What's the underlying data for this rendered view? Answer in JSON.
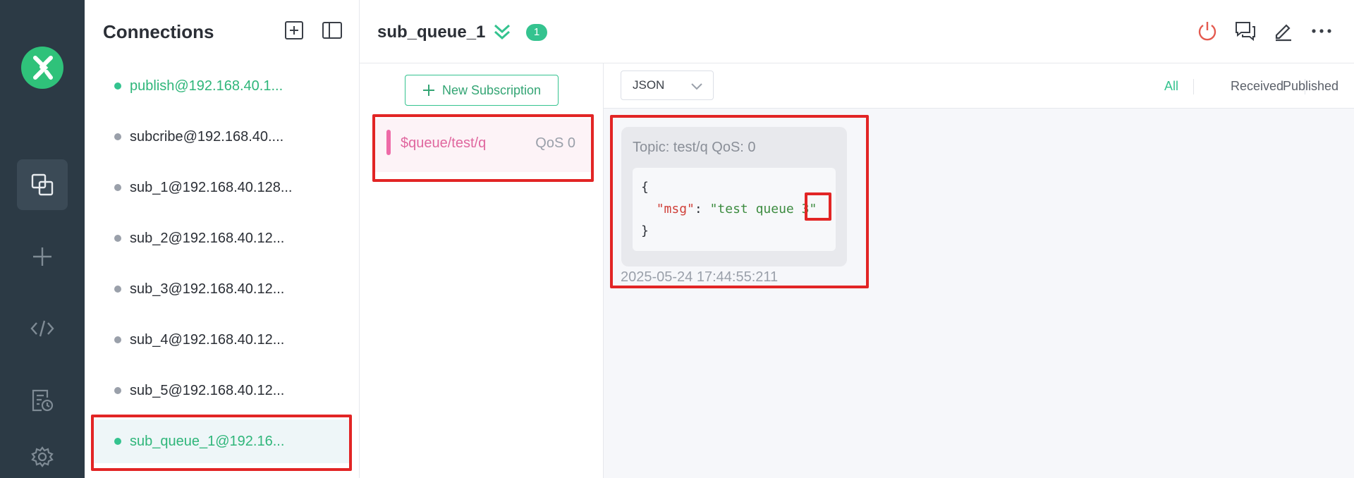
{
  "rail": {
    "logo_icon": "mqttx-logo-icon",
    "items": [
      {
        "icon": "connections-icon",
        "active": true
      },
      {
        "icon": "plus-icon"
      },
      {
        "icon": "code-icon"
      },
      {
        "icon": "log-icon"
      },
      {
        "icon": "gear-icon"
      }
    ]
  },
  "connections": {
    "title": "Connections",
    "items": [
      {
        "label": "publish@192.168.40.1...",
        "online": true
      },
      {
        "label": "subcribe@192.168.40....",
        "online": false
      },
      {
        "label": "sub_1@192.168.40.128...",
        "online": false
      },
      {
        "label": "sub_2@192.168.40.12...",
        "online": false
      },
      {
        "label": "sub_3@192.168.40.12...",
        "online": false
      },
      {
        "label": "sub_4@192.168.40.12...",
        "online": false
      },
      {
        "label": "sub_5@192.168.40.12...",
        "online": false
      },
      {
        "label": "sub_queue_1@192.16...",
        "online": true,
        "selected": true
      }
    ]
  },
  "topbar": {
    "title": "sub_queue_1",
    "badge": "1"
  },
  "subscriptions": {
    "new_label": "New Subscription",
    "items": [
      {
        "topic": "$queue/test/q",
        "qos": "QoS 0",
        "color": "#ee6aa7"
      }
    ]
  },
  "messages": {
    "format": "JSON",
    "filters": {
      "all": "All",
      "received": "Received",
      "published": "Published"
    },
    "card": {
      "meta": "Topic: test/q    QoS: 0",
      "brace_open": "{",
      "key": "\"msg\"",
      "colon": ": ",
      "value_pre": "\"test queue ",
      "value_hl": "3\"",
      "brace_close": "}",
      "time": "2025-05-24 17:44:55:211"
    }
  },
  "colors": {
    "accent": "#34c38f",
    "highlight_border": "#e22525",
    "rail_bg": "#2c3a45"
  }
}
